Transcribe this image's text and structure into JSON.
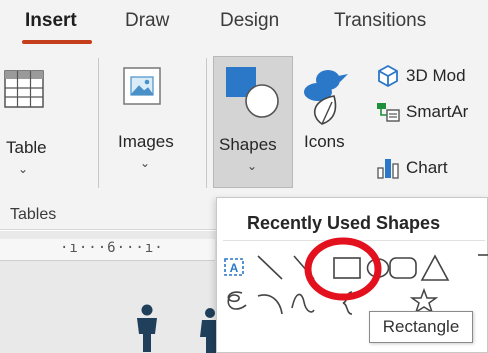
{
  "tabs": [
    {
      "label": "Insert",
      "active": true
    },
    {
      "label": "Draw"
    },
    {
      "label": "Design"
    },
    {
      "label": "Transitions"
    }
  ],
  "ribbon": {
    "table_label": "Table",
    "images_label": "Images",
    "shapes_label": "Shapes",
    "icons_label": "Icons",
    "models_label": "3D Mod",
    "smartart_label": "SmartAr",
    "chart_label": "Chart",
    "tables_group_label": "Tables",
    "chevron": "⌄"
  },
  "ruler": {
    "text": "·ı···6···ı·"
  },
  "dropdown": {
    "title": "Recently Used Shapes",
    "tooltip": "Rectangle",
    "highlight_color": "#e3101d"
  },
  "colors": {
    "accent": "#c43e1c",
    "ribbon_bg": "#f3f3f3",
    "icon_blue": "#2b77c8",
    "figure": "#1f3f5b"
  }
}
